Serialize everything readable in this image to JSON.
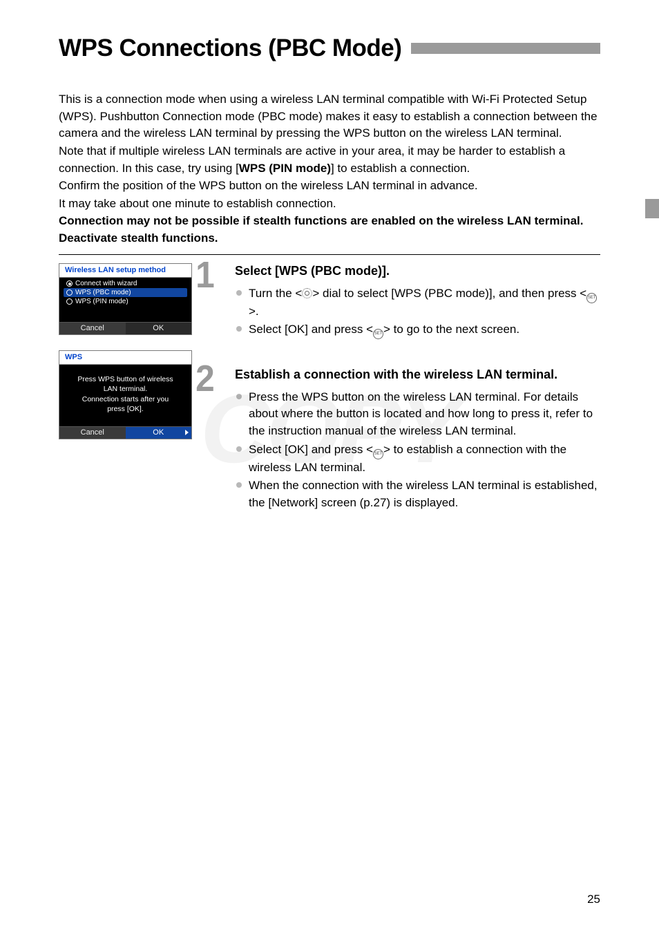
{
  "title": "WPS Connections (PBC Mode)",
  "intro": {
    "p1a": "This is a connection mode when using a wireless LAN terminal compatible with Wi-Fi Protected Setup (WPS). Pushbutton Connection mode (PBC mode) makes it easy to establish a connection between the camera and the wireless LAN terminal by pressing the WPS button on the wireless LAN terminal.",
    "p2a": "Note that if multiple wireless LAN terminals are active in your area, it may be harder to establish a connection. In this case, try using [",
    "p2b": "WPS (PIN mode)",
    "p2c": "] to establish a connection.",
    "p3": "Confirm the position of the WPS button on the wireless LAN terminal in advance.",
    "p4": "It may take about one minute to establish connection.",
    "p5": "Connection may not be possible if stealth functions are enabled on the wireless LAN terminal. Deactivate stealth functions."
  },
  "shot1": {
    "title": "Wireless LAN setup method",
    "opt1": "Connect with wizard",
    "opt2": "WPS (PBC mode)",
    "opt3": "WPS (PIN mode)",
    "cancel": "Cancel",
    "ok": "OK"
  },
  "shot2": {
    "title": "WPS",
    "msg": "Press WPS button of wireless LAN terminal. Connection starts after you press [OK].",
    "l1": "Press WPS button of wireless",
    "l2": "LAN terminal.",
    "l3": "Connection starts after you",
    "l4": "press [OK].",
    "cancel": "Cancel",
    "ok": "OK"
  },
  "step1": {
    "num": "1",
    "heading": "Select [WPS (PBC mode)].",
    "b1a": "Turn the <",
    "b1b": "> dial to select [",
    "b1c": "WPS (PBC mode)",
    "b1d": "], and then press <",
    "b1e": ">.",
    "b2a": "Select [",
    "b2b": "OK",
    "b2c": "] and press <",
    "b2d": "> to go to the next screen."
  },
  "step2": {
    "num": "2",
    "heading": "Establish a connection with the wireless LAN terminal.",
    "b1": "Press the WPS button on the wireless LAN terminal. For details about where the button is located and how long to press it, refer to the instruction manual of the wireless LAN terminal.",
    "b2a": "Select [",
    "b2b": "OK",
    "b2c": "] and press <",
    "b2d": "> to establish a connection with the wireless LAN terminal.",
    "b3a": "When the connection with the wireless LAN terminal is established, the [",
    "b3b": "Network",
    "b3c": "] screen (p.27) is displayed."
  },
  "watermark": "COPY",
  "pagenum": "25",
  "icons": {
    "set_label": "SET"
  }
}
